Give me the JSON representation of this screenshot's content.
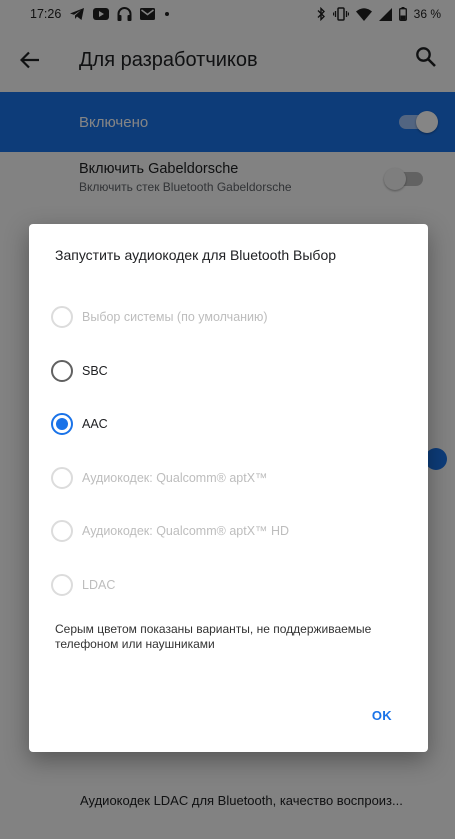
{
  "status_bar": {
    "time": "17:26",
    "battery_percent": "36 %",
    "icons_left": [
      "telegram-icon",
      "youtube-icon",
      "headphones-icon",
      "mail-icon",
      "dot-icon"
    ],
    "icons_right": [
      "bluetooth-icon",
      "vibrate-icon",
      "wifi-icon",
      "signal-icon",
      "battery-icon"
    ]
  },
  "app_bar": {
    "title": "Для разработчиков",
    "back_icon": "arrow-left-icon",
    "search_icon": "search-icon"
  },
  "master_switch": {
    "label": "Включено",
    "on": true,
    "accent": "#1a73e8"
  },
  "preferences": [
    {
      "title": "Включить Gabeldorsche",
      "subtitle": "Включить стек Bluetooth Gabeldorsche",
      "on": false
    }
  ],
  "bottom_item": {
    "text": "Аудиокодек LDAC для Bluetooth, качество воспроиз..."
  },
  "dialog": {
    "title": "Запустить аудиокодек для Bluetooth Выбор",
    "options": [
      {
        "label": "Выбор системы (по умолчанию)",
        "state": "disabled"
      },
      {
        "label": "SBC",
        "state": "enabled"
      },
      {
        "label": "AAC",
        "state": "checked"
      },
      {
        "label": "Аудиокодек: Qualcomm® aptX™",
        "state": "disabled"
      },
      {
        "label": "Аудиокодек: Qualcomm® aptX™ HD",
        "state": "disabled"
      },
      {
        "label": "LDAC",
        "state": "disabled"
      }
    ],
    "note": "Серым цветом показаны варианты, не поддерживаемые телефоном или наушниками",
    "ok_label": "OK"
  }
}
